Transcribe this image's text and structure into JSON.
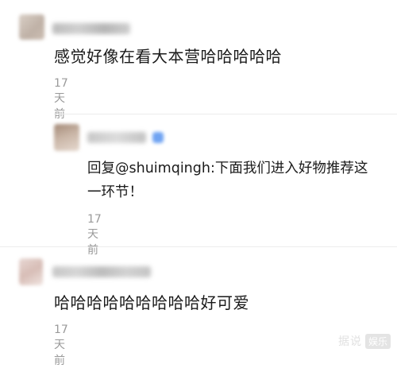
{
  "comments": [
    {
      "text": "感觉好像在看大本营哈哈哈哈哈",
      "time": "17天前",
      "reply": {
        "text_line1": "回复@shuimqingh:下面我们进入好物推荐这",
        "text_line2": "一环节！",
        "time": "17天前"
      }
    },
    {
      "text": "哈哈哈哈哈哈哈哈哈好可爱",
      "time": "17天前"
    }
  ],
  "watermark": {
    "text": "据说",
    "box": "娱乐"
  },
  "colors": {
    "time_gray": "#9a9a9a",
    "body_text": "#1a1a1a",
    "divider": "#ececec",
    "vip_blue": "#6fa3f2"
  }
}
